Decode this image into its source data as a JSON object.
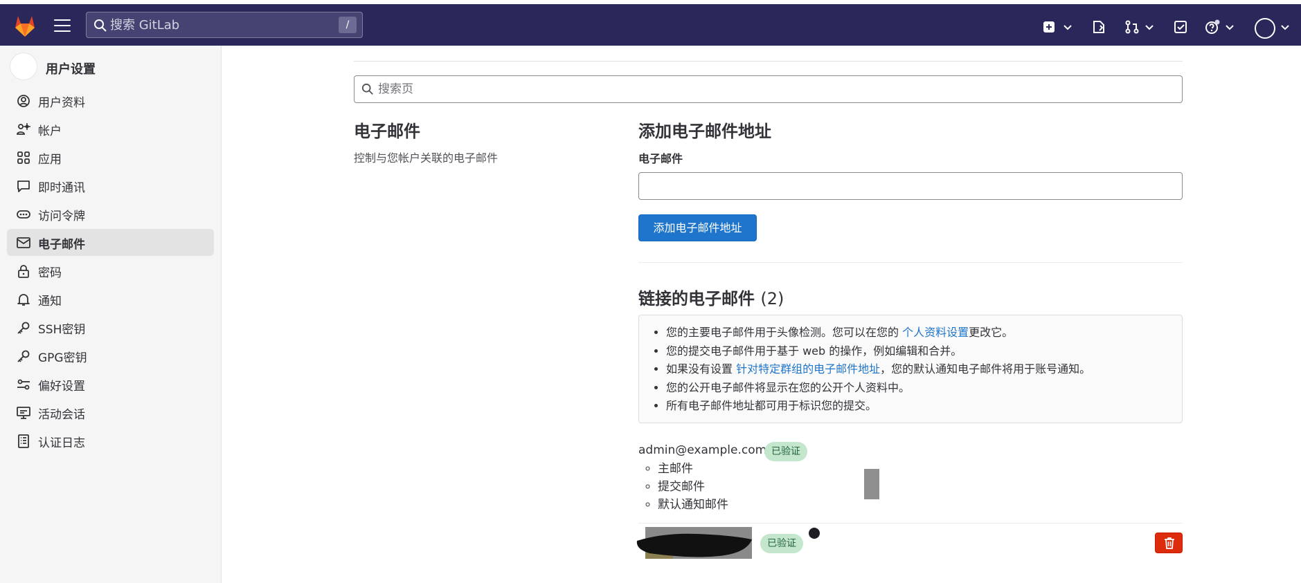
{
  "topbar": {
    "search_placeholder": "搜索 GitLab",
    "search_shortcut": "/",
    "icons": [
      "gitlab-logo",
      "hamburger-icon",
      "search-icon",
      "plus-square-icon",
      "merge-request-icon",
      "issues-icon",
      "todo-icon",
      "help-icon",
      "user-avatar"
    ]
  },
  "sidebar": {
    "title": "用户设置",
    "items": [
      {
        "label": "用户资料",
        "icon": "user-icon"
      },
      {
        "label": "帐户",
        "icon": "account-icon"
      },
      {
        "label": "应用",
        "icon": "applications-icon"
      },
      {
        "label": "即时通讯",
        "icon": "chat-icon"
      },
      {
        "label": "访问令牌",
        "icon": "token-icon"
      },
      {
        "label": "电子邮件",
        "icon": "mail-icon",
        "active": true
      },
      {
        "label": "密码",
        "icon": "lock-icon"
      },
      {
        "label": "通知",
        "icon": "bell-icon"
      },
      {
        "label": "SSH密钥",
        "icon": "key-icon"
      },
      {
        "label": "GPG密钥",
        "icon": "key-icon"
      },
      {
        "label": "偏好设置",
        "icon": "preferences-icon"
      },
      {
        "label": "活动会话",
        "icon": "monitor-icon"
      },
      {
        "label": "认证日志",
        "icon": "log-icon"
      }
    ]
  },
  "main": {
    "search_placeholder": "搜索页",
    "section_title": "电子邮件",
    "section_desc": "控制与您帐户关联的电子邮件",
    "add_title": "添加电子邮件地址",
    "email_label": "电子邮件",
    "email_value": "",
    "add_button": "添加电子邮件地址",
    "linked_title": "链接的电子邮件",
    "linked_count": "(2)",
    "info": {
      "li1_pre": "您的主要电子邮件用于头像检测。您可以在您的 ",
      "li1_link": "个人资料设置",
      "li1_post": "更改它。",
      "li2": "您的提交电子邮件用于基于 web 的操作，例如编辑和合并。",
      "li3_pre": "如果没有设置 ",
      "li3_link": "针对特定群组的电子邮件地址",
      "li3_post": "，您的默认通知电子邮件将用于账号通知。",
      "li4": "您的公开电子邮件将显示在您的公开个人资料中。",
      "li5": "所有电子邮件地址都可用于标识您的提交。"
    },
    "emails": [
      {
        "address": "admin@example.com",
        "badge": "已验证",
        "roles": [
          "主邮件",
          "提交邮件",
          "默认通知邮件"
        ]
      },
      {
        "address": "",
        "badge": "已验证",
        "roles": []
      }
    ]
  },
  "colors": {
    "topbar": "#2a285a",
    "primary": "#1f75cb",
    "danger": "#dd2b0e",
    "badge_bg": "#c3e6cd",
    "badge_text": "#24663b"
  }
}
